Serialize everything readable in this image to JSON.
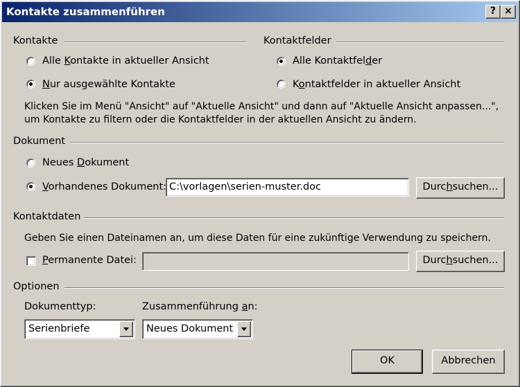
{
  "window": {
    "title": "Kontakte zusammenführen",
    "help_label": "?",
    "close_label": "×"
  },
  "kontakte": {
    "heading": "Kontakte",
    "options": [
      {
        "pre": "Alle ",
        "key": "K",
        "post": "ontakte in aktueller Ansicht",
        "selected": false
      },
      {
        "pre": "",
        "key": "N",
        "post": "ur ausgewählte Kontakte",
        "selected": true
      }
    ]
  },
  "kontaktfelder": {
    "heading": "Kontaktfelder",
    "options": [
      {
        "pre": "Alle Kontaktfel",
        "key": "d",
        "post": "er",
        "selected": true
      },
      {
        "pre": "K",
        "key": "o",
        "post": "ntaktfelder in aktueller Ansicht",
        "selected": false
      }
    ]
  },
  "info": {
    "line1": "Klicken Sie im Menü \"Ansicht\" auf \"Aktuelle Ansicht\" und dann auf \"Aktuelle Ansicht anpassen...\",",
    "line2": "um Kontakte zu filtern oder die Kontaktfelder in der aktuellen Ansicht zu ändern."
  },
  "dokument": {
    "heading": "Dokument",
    "new": {
      "pre": "Neues ",
      "key": "D",
      "post": "okument",
      "selected": false
    },
    "existing": {
      "pre": "",
      "key": "V",
      "post": "orhandenes Dokument:",
      "selected": true
    },
    "path": "C:\\vorlagen\\serien-muster.doc",
    "browse": {
      "pre": "Durc",
      "key": "h",
      "post": "suchen..."
    }
  },
  "kontaktdaten": {
    "heading": "Kontaktdaten",
    "info": "Geben Sie einen Dateinamen an, um diese Daten für eine zukünftige Verwendung zu speichern.",
    "permanent": {
      "pre": "",
      "key": "P",
      "post": "ermanente Datei:",
      "checked": false
    },
    "file_value": "",
    "browse": {
      "pre": "Durc",
      "key": "h",
      "post": "suchen..."
    }
  },
  "optionen": {
    "heading": "Optionen",
    "doctype_label": "Dokumenttyp:",
    "doctype_value": "Serienbriefe",
    "merge_label_pre": "Zusammenführung ",
    "merge_label_key": "a",
    "merge_label_post": "n:",
    "merge_value": "Neues Dokument"
  },
  "buttons": {
    "ok": "OK",
    "cancel": "Abbrechen"
  }
}
